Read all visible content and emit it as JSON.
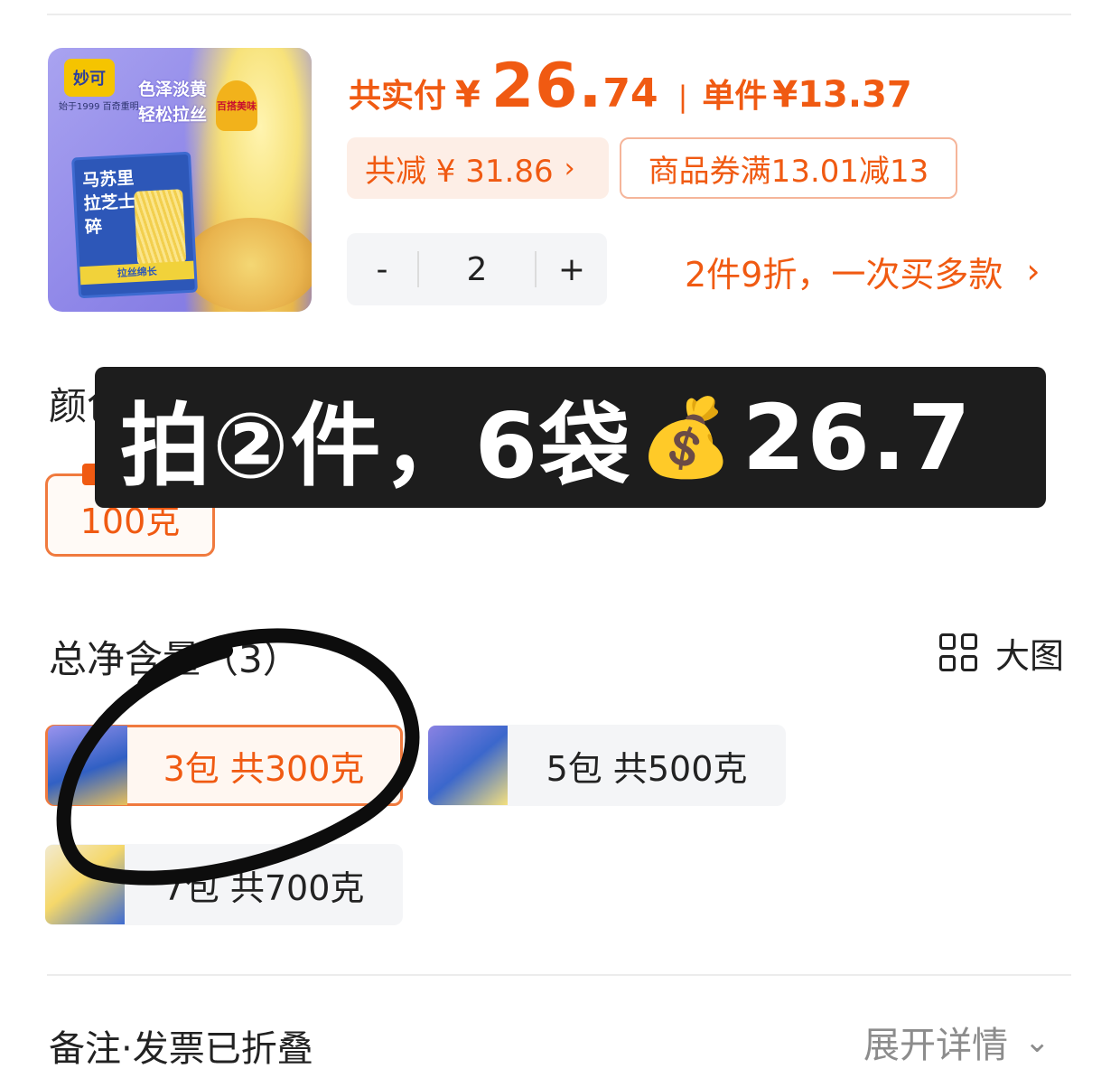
{
  "product": {
    "image_alt": "马苏里拉芝士碎",
    "thumb_logo": "妙可",
    "thumb_logo_sub": "始于1999 百奇重明",
    "thumb_slogan": "色泽淡黄 轻松拉丝",
    "thumb_badge": "百搭美味",
    "thumb_pack_title": "马苏里拉芝士碎",
    "thumb_pack_band": "拉丝绵长"
  },
  "price": {
    "label": "共实付",
    "currency": "¥",
    "integer": "26.",
    "decimal": "74",
    "separator": "|",
    "unit_label": "单件",
    "unit_price": "¥13.37"
  },
  "discount": {
    "text": "共减 ¥ 31.86",
    "chevron": "›",
    "coupon_text": "商品券满13.01减13"
  },
  "quantity": {
    "minus": "-",
    "value": "2",
    "plus": "+"
  },
  "promo": {
    "text": "2件9折，一次买多款",
    "chevron": "›"
  },
  "color_section": {
    "title": "颜色分类",
    "option_label": "100克"
  },
  "overlay": {
    "text_before": "拍②件，6袋",
    "money_emoji": "💰",
    "text_after": "26.7"
  },
  "net_section": {
    "title": "总净含量（3）",
    "large_view_label": "大图",
    "options": [
      {
        "label": "3包 共300克",
        "selected": true
      },
      {
        "label": "5包 共500克",
        "selected": false
      },
      {
        "label": "7包 共700克",
        "selected": false
      }
    ]
  },
  "footer": {
    "remark_label": "备注·发票已折叠",
    "expand_label": "展开详情",
    "expand_chevron": "⌄"
  },
  "colors": {
    "accent": "#f05a12",
    "chip_bg": "#fdeee6",
    "neutral_bg": "#f4f5f7",
    "overlay_bg": "#1d1d1d"
  }
}
